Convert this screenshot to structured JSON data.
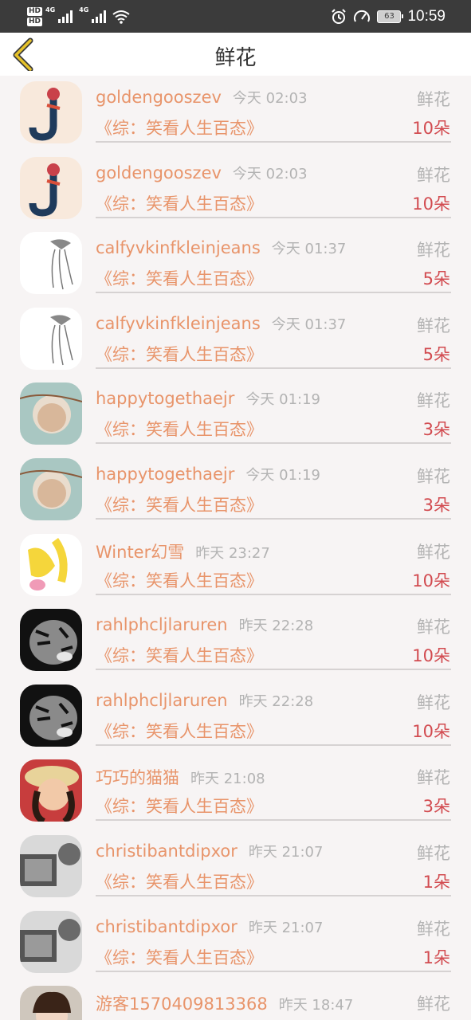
{
  "status_bar": {
    "hd_top": "HD",
    "hd_bottom": "HD",
    "network_1": "4G",
    "network_2": "4G",
    "battery": "63",
    "time": "10:59"
  },
  "header": {
    "title": "鲜花"
  },
  "colors": {
    "name": "#e8946a",
    "count": "#d24b50",
    "muted": "#b3b3b3",
    "back_arrow": "#e6c229"
  },
  "list": [
    {
      "name": "goldengooszev",
      "time": "今天 02:03",
      "gift": "鲜花",
      "work": "《综：笑看人生百态》",
      "count": "10朵",
      "avatar": "letter-j-avatar"
    },
    {
      "name": "goldengooszev",
      "time": "今天 02:03",
      "gift": "鲜花",
      "work": "《综：笑看人生百态》",
      "count": "10朵",
      "avatar": "letter-j-avatar"
    },
    {
      "name": "calfyvkinfkleinjeans",
      "time": "今天 01:37",
      "gift": "鲜花",
      "work": "《综：笑看人生百态》",
      "count": "5朵",
      "avatar": "sketch-girl-avatar"
    },
    {
      "name": "calfyvkinfkleinjeans",
      "time": "今天 01:37",
      "gift": "鲜花",
      "work": "《综：笑看人生百态》",
      "count": "5朵",
      "avatar": "sketch-girl-avatar"
    },
    {
      "name": "happytogethaejr",
      "time": "今天 01:19",
      "gift": "鲜花",
      "work": "《综：笑看人生百态》",
      "count": "3朵",
      "avatar": "glass-bottle-avatar"
    },
    {
      "name": "happytogethaejr",
      "time": "今天 01:19",
      "gift": "鲜花",
      "work": "《综：笑看人生百态》",
      "count": "3朵",
      "avatar": "glass-bottle-avatar"
    },
    {
      "name": "Winter幻雪",
      "time": "昨天 23:27",
      "gift": "鲜花",
      "work": "《综：笑看人生百态》",
      "count": "10朵",
      "avatar": "cartoon-avatar"
    },
    {
      "name": "rahlphcljlaruren",
      "time": "昨天 22:28",
      "gift": "鲜花",
      "work": "《综：笑看人生百态》",
      "count": "10朵",
      "avatar": "tiger-avatar"
    },
    {
      "name": "rahlphcljlaruren",
      "time": "昨天 22:28",
      "gift": "鲜花",
      "work": "《综：笑看人生百态》",
      "count": "10朵",
      "avatar": "tiger-avatar"
    },
    {
      "name": "巧巧的猫猫",
      "time": "昨天 21:08",
      "gift": "鲜花",
      "work": "《综：笑看人生百态》",
      "count": "3朵",
      "avatar": "girl-hat-avatar"
    },
    {
      "name": "christibantdipxor",
      "time": "昨天 21:07",
      "gift": "鲜花",
      "work": "《综：笑看人生百态》",
      "count": "1朵",
      "avatar": "bw-photo-avatar"
    },
    {
      "name": "christibantdipxor",
      "time": "昨天 21:07",
      "gift": "鲜花",
      "work": "《综：笑看人生百态》",
      "count": "1朵",
      "avatar": "bw-photo-avatar"
    },
    {
      "name": "游客1570409813368",
      "time": "昨天 18:47",
      "gift": "鲜花",
      "work": "",
      "count": "",
      "avatar": "person-photo-avatar"
    }
  ]
}
